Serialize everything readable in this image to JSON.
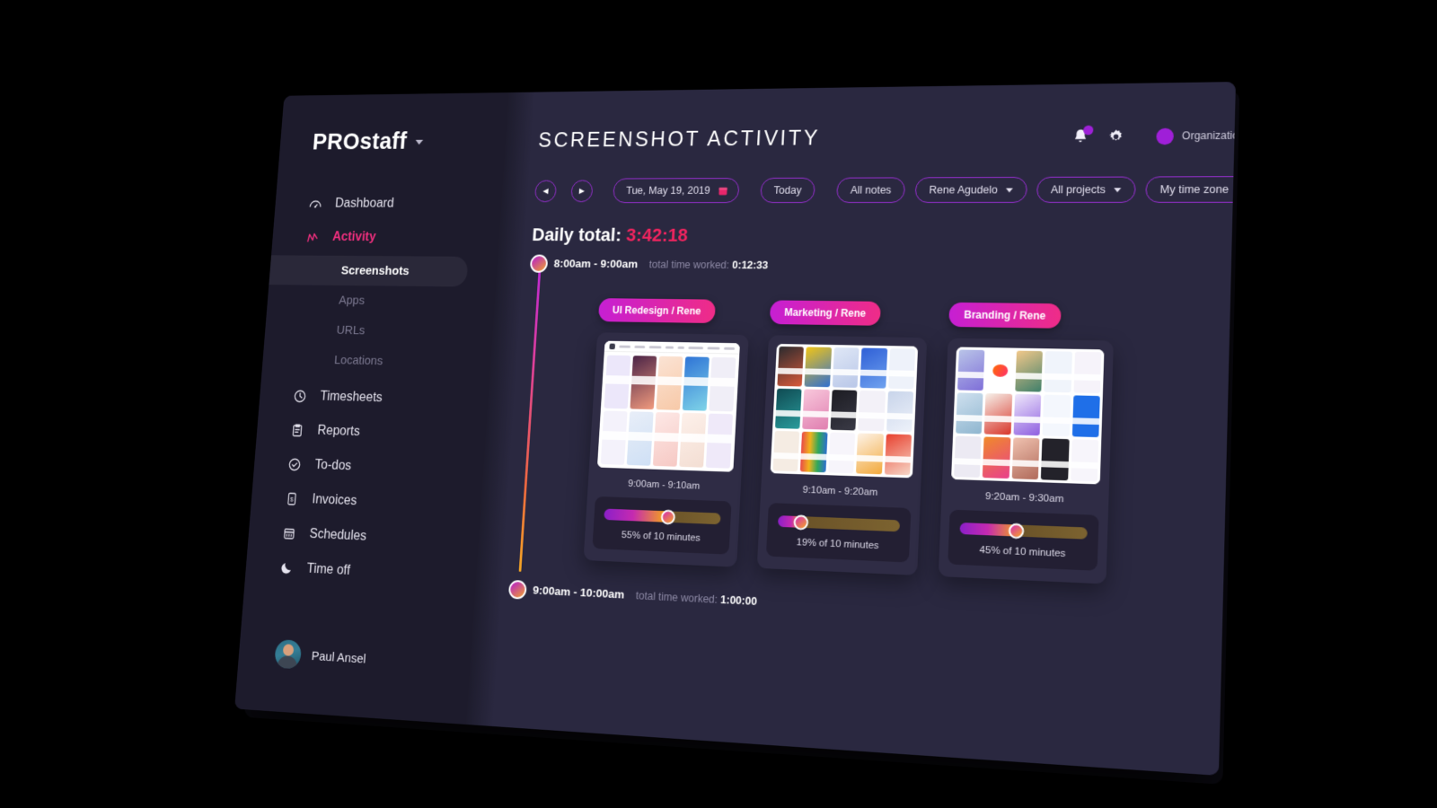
{
  "brand": {
    "name": "PROstaff",
    "caret_icon": "chevron-down-icon"
  },
  "sidebar": {
    "items": [
      {
        "label": "Dashboard",
        "icon": "speedometer-icon",
        "active": false
      },
      {
        "label": "Activity",
        "icon": "activity-graph-icon",
        "active": true
      },
      {
        "label": "Timesheets",
        "icon": "clock-icon",
        "active": false
      },
      {
        "label": "Reports",
        "icon": "clipboard-icon",
        "active": false
      },
      {
        "label": "To-dos",
        "icon": "check-circle-icon",
        "active": false
      },
      {
        "label": "Invoices",
        "icon": "invoice-dollar-icon",
        "active": false
      },
      {
        "label": "Schedules",
        "icon": "calendar-icon",
        "active": false
      },
      {
        "label": "Time off",
        "icon": "moon-icon",
        "active": false
      }
    ],
    "sub_items": [
      {
        "label": "Screenshots",
        "selected": true
      },
      {
        "label": "Apps",
        "selected": false
      },
      {
        "label": "URLs",
        "selected": false
      },
      {
        "label": "Locations",
        "selected": false
      }
    ],
    "profile": {
      "name": "Paul Ansel",
      "avatar_icon": "user-avatar"
    }
  },
  "header": {
    "title": "SCREENSHOT ACTIVITY",
    "bell_icon": "bell-icon",
    "settings_icon": "gear-icon",
    "org_label": "Organization",
    "org_caret_icon": "chevron-down-icon"
  },
  "filters": {
    "prev_label": "◀",
    "next_label": "▶",
    "date_value": "Tue, May 19, 2019",
    "calendar_icon": "calendar-icon",
    "today_label": "Today",
    "all_notes_label": "All notes",
    "right": [
      {
        "label": "Rene Agudelo"
      },
      {
        "label": "All projects"
      },
      {
        "label": "My time zone"
      }
    ]
  },
  "summary": {
    "daily_total_label": "Daily total:",
    "daily_total_value": "3:42:18"
  },
  "timeline": [
    {
      "time_range": "8:00am - 9:00am",
      "worked_label": "total time worked:",
      "worked_value": "0:12:33"
    },
    {
      "time_range": "9:00am - 10:00am",
      "worked_label": "total time worked:",
      "worked_value": "1:00:00"
    }
  ],
  "screenshots": [
    {
      "tag": "UI Redesign / Rene",
      "time_range": "9:00am - 9:10am",
      "percent": 55,
      "percent_label": "55% of 10 minutes"
    },
    {
      "tag": "Marketing / Rene",
      "time_range": "9:10am - 9:20am",
      "percent": 19,
      "percent_label": "19% of 10 minutes"
    },
    {
      "tag": "Branding / Rene",
      "time_range": "9:20am - 9:30am",
      "percent": 45,
      "percent_label": "45% of 10 minutes"
    }
  ],
  "colors": {
    "accent_pink": "#ef2f7e",
    "accent_purple": "#9a2fd4",
    "total_red": "#f0245f",
    "panel_bg": "#2a2840",
    "sidebar_bg": "#1d1b2c"
  }
}
